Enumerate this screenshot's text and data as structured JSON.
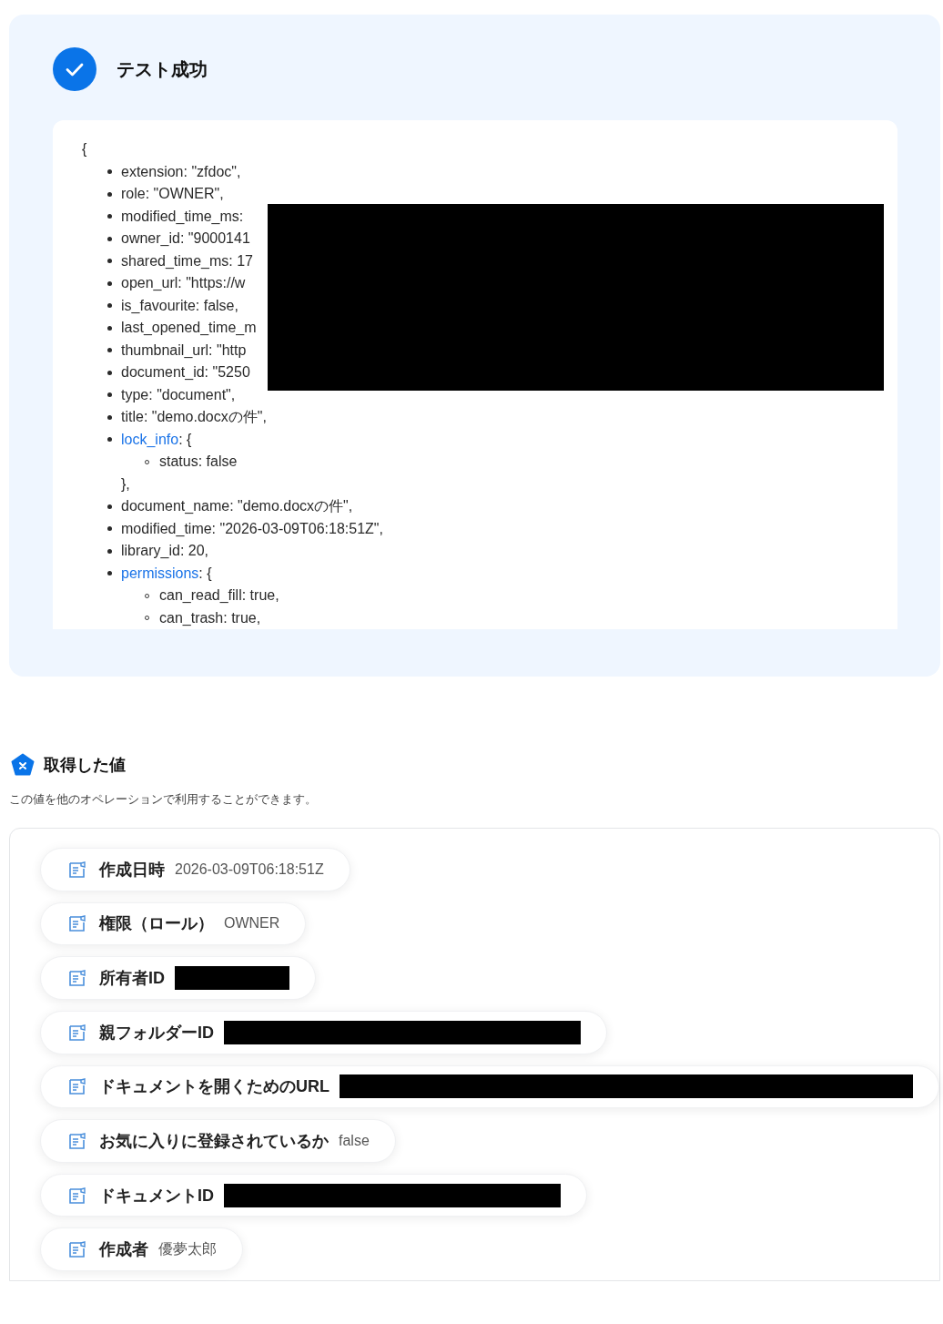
{
  "test_result": {
    "title": "テスト成功",
    "success": true,
    "code": {
      "open": "{",
      "redacted": true,
      "lines": [
        {
          "kind": "item",
          "text": "extension: \"zfdoc\","
        },
        {
          "kind": "item",
          "text": "role: \"OWNER\","
        },
        {
          "kind": "item",
          "text": "modified_time_ms:"
        },
        {
          "kind": "item",
          "text": "owner_id: \"9000141"
        },
        {
          "kind": "item",
          "text": "shared_time_ms: 17"
        },
        {
          "kind": "item",
          "text": "open_url: \"https://w"
        },
        {
          "kind": "item",
          "text": "is_favourite: false,"
        },
        {
          "kind": "item",
          "text": "last_opened_time_m"
        },
        {
          "kind": "item",
          "text": "thumbnail_url: \"http"
        },
        {
          "kind": "item",
          "text": "document_id: \"5250"
        },
        {
          "kind": "item",
          "text": "type: \"document\","
        },
        {
          "kind": "item",
          "text": "title: \"demo.docxの件\","
        },
        {
          "kind": "object",
          "key": "lock_info",
          "suffix": ": {",
          "children": [
            "status: false"
          ],
          "close": "},"
        },
        {
          "kind": "item",
          "text": "document_name: \"demo.docxの件\","
        },
        {
          "kind": "item",
          "text": "modified_time: \"2026-03-09T06:18:51Z\","
        },
        {
          "kind": "item",
          "text": "library_id: 20,"
        },
        {
          "kind": "object",
          "key": "permissions",
          "suffix": ": {",
          "children": [
            "can_read_fill: true,",
            "can_trash: true,"
          ]
        }
      ]
    }
  },
  "acquired_values": {
    "title": "取得した値",
    "description": "この値を他のオペレーションで利用することができます。",
    "items": [
      {
        "label": "作成日時",
        "kind": "text",
        "value": "2026-03-09T06:18:51Z"
      },
      {
        "label": "権限（ロール）",
        "kind": "text",
        "value": "OWNER"
      },
      {
        "label": "所有者ID",
        "kind": "redacted"
      },
      {
        "label": "親フォルダーID",
        "kind": "redacted"
      },
      {
        "label": "ドキュメントを開くためのURL",
        "kind": "redacted"
      },
      {
        "label": "お気に入りに登録されているか",
        "kind": "text",
        "value": "false"
      },
      {
        "label": "ドキュメントID",
        "kind": "redacted"
      },
      {
        "label": "作成者",
        "kind": "text",
        "value": "優夢太郎"
      }
    ]
  }
}
